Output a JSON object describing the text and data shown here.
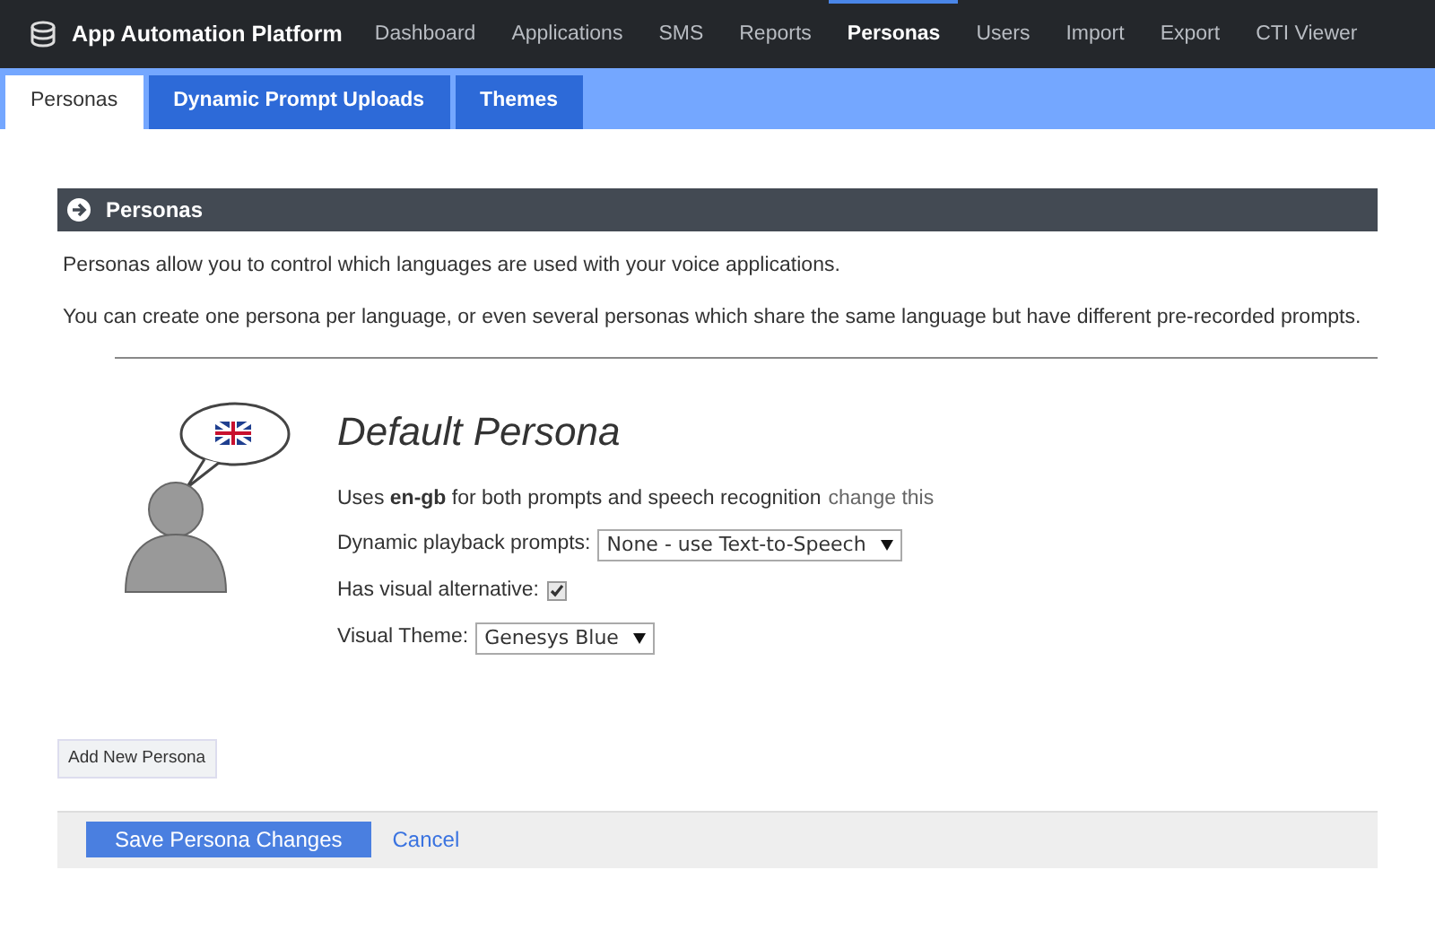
{
  "app": {
    "title": "App Automation Platform"
  },
  "nav": [
    {
      "label": "Dashboard",
      "selected": false
    },
    {
      "label": "Applications",
      "selected": false
    },
    {
      "label": "SMS",
      "selected": false
    },
    {
      "label": "Reports",
      "selected": false
    },
    {
      "label": "Personas",
      "selected": true
    },
    {
      "label": "Users",
      "selected": false
    },
    {
      "label": "Import",
      "selected": false
    },
    {
      "label": "Export",
      "selected": false
    },
    {
      "label": "CTI Viewer",
      "selected": false
    }
  ],
  "tabs": [
    {
      "label": "Personas",
      "selected": true
    },
    {
      "label": "Dynamic Prompt Uploads",
      "selected": false
    },
    {
      "label": "Themes",
      "selected": false
    }
  ],
  "section": {
    "title": "Personas",
    "intro": [
      "Personas allow you to control which languages are used with your voice applications.",
      "You can create one persona per language, or even several personas which share the same language but have different pre-recorded prompts."
    ]
  },
  "persona": {
    "name": "Default Persona",
    "language_text": "Uses **en-gb** for both prompts and speech recognition",
    "change_link": "change this",
    "fields": [
      {
        "kind": "select",
        "label": "Dynamic playback prompts:",
        "value": "None - use Text-to-Speech"
      },
      {
        "kind": "checkbox",
        "label": "Has visual alternative:",
        "checked": true
      },
      {
        "kind": "select",
        "label": "Visual Theme:",
        "value": "Genesys Blue"
      }
    ]
  },
  "add_button": "Add New Persona",
  "footer": {
    "save": "Save Persona Changes",
    "cancel": "Cancel"
  }
}
